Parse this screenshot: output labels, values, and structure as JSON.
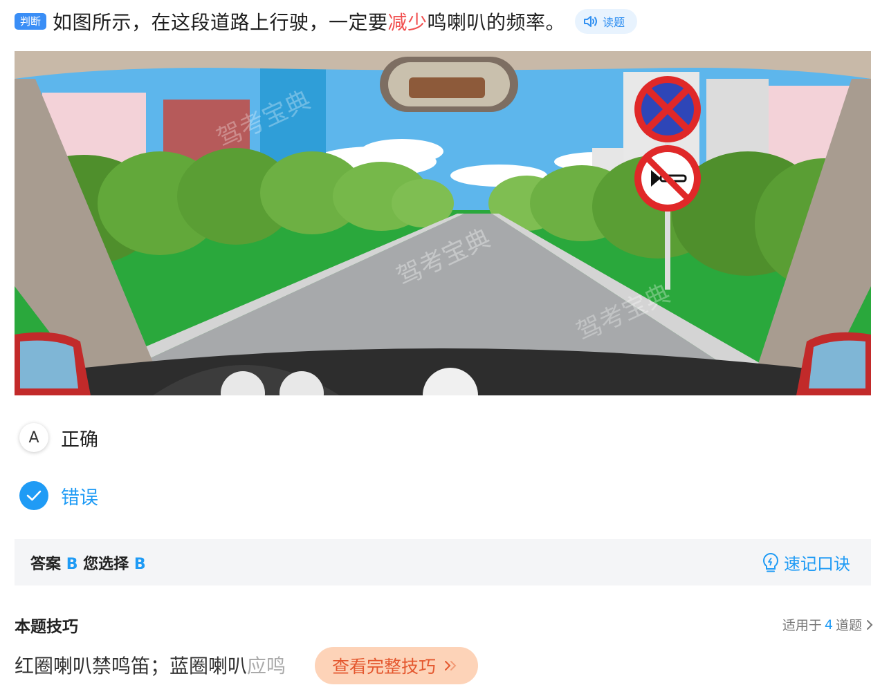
{
  "question": {
    "type_tag": "判断",
    "text_before": "如图所示，在这段道路上行驶，一定要",
    "text_highlight": "减少",
    "text_after": "鸣喇叭的频率。",
    "read_label": "读题"
  },
  "scene": {
    "watermark": "驾考宝典",
    "signs": [
      "no-stopping-sign-icon",
      "no-horn-sign-icon"
    ]
  },
  "options": [
    {
      "letter": "A",
      "label": "正确",
      "selected": false
    },
    {
      "letter": "B",
      "label": "错误",
      "selected": true
    }
  ],
  "answer_bar": {
    "answer_label": "答案",
    "answer_value": "B",
    "chosen_label": "您选择",
    "chosen_value": "B",
    "memo_label": "速记口诀"
  },
  "tips": {
    "title": "本题技巧",
    "applies_prefix": "适用于",
    "applies_count": "4",
    "applies_suffix": "道题",
    "body_visible": "红圈喇叭禁鸣笛；蓝圈喇叭",
    "body_faded": "应鸣",
    "full_button": "查看完整技巧"
  },
  "colors": {
    "accent": "#1f9bf5",
    "highlight": "#f14f4f",
    "button_bg": "#fdd3b8",
    "button_text": "#e4572e"
  }
}
